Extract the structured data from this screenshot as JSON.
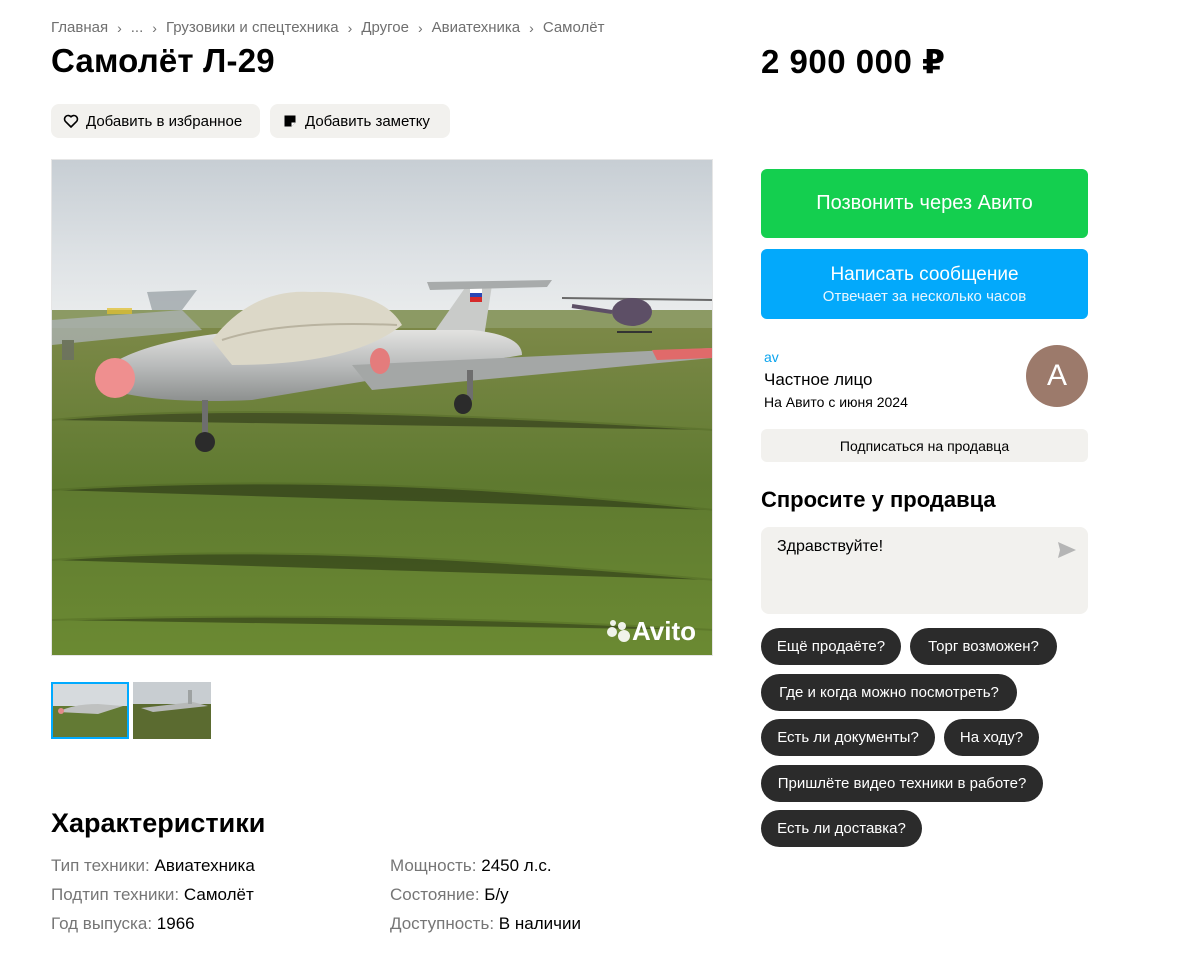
{
  "breadcrumb": [
    "Главная",
    "...",
    "Грузовики и спецтехника",
    "Другое",
    "Авиатехника",
    "Самолёт"
  ],
  "title": "Самолёт Л-29",
  "price": "2 900 000 ₽",
  "actions": {
    "favorite": "Добавить в избранное",
    "note": "Добавить заметку"
  },
  "photo": {
    "watermark": "Avito",
    "thumbnails": 2,
    "selected_thumbnail": 1
  },
  "specs": {
    "title": "Характеристики",
    "items": [
      {
        "label": "Тип техники:",
        "value": "Авиатехника"
      },
      {
        "label": "Подтип техники:",
        "value": "Самолёт"
      },
      {
        "label": "Год выпуска:",
        "value": "1966"
      },
      {
        "label": "Мощность:",
        "value": "2450 л.с."
      },
      {
        "label": "Состояние:",
        "value": "Б/у"
      },
      {
        "label": "Доступность:",
        "value": "В наличии"
      }
    ]
  },
  "contact": {
    "call": "Позвонить через Авито",
    "message": "Написать сообщение",
    "message_sub": "Отвечает за несколько часов"
  },
  "seller": {
    "login": "av",
    "type": "Частное лицо",
    "since": "На Авито с июня 2024",
    "avatar_letter": "A",
    "subscribe": "Подписаться на продавца"
  },
  "ask": {
    "title": "Спросите у продавца",
    "input_value": "Здравствуйте!",
    "chips": [
      "Ещё продаёте?",
      "Торг возможен?",
      "Где и когда можно посмотреть?",
      "Есть ли документы?",
      "На ходу?",
      "Пришлёте видео техники в работе?",
      "Есть ли доставка?"
    ]
  },
  "colors": {
    "call_button": "#14cf4f",
    "message_button": "#03a9fb",
    "chip": "#2b2b2b",
    "accent_link": "#0aa4ee",
    "avatar": "#9c7a6b"
  },
  "icons": {
    "favorite": "heart-icon",
    "note": "note-icon",
    "send": "send-icon"
  }
}
